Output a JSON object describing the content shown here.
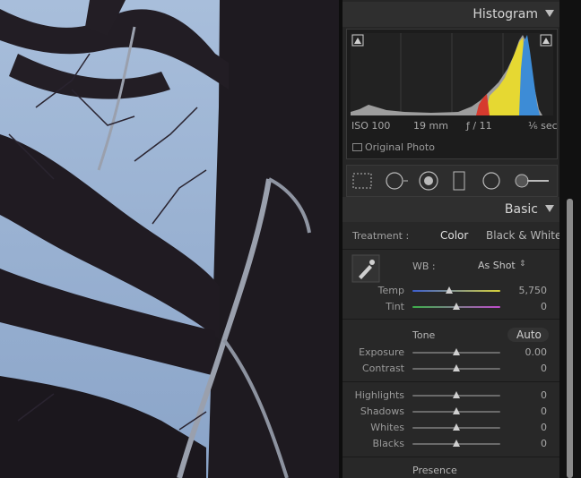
{
  "histogram": {
    "title": "Histogram",
    "iso": "ISO 100",
    "focal": "19 mm",
    "aperture": "ƒ / 11",
    "shutter": "⅙ sec",
    "original_photo": "Original Photo"
  },
  "tools": [
    "crop-overlay-icon",
    "spot-removal-icon",
    "red-eye-icon",
    "graduated-filter-icon",
    "radial-filter-icon",
    "adjustment-brush-icon"
  ],
  "basic": {
    "title": "Basic",
    "treatment_label": "Treatment :",
    "color": "Color",
    "bw": "Black & White",
    "wb_label": "WB :",
    "wb_value": "As Shot",
    "temp": {
      "label": "Temp",
      "value": "5,750",
      "level": 0.42
    },
    "tint": {
      "label": "Tint",
      "value": "0",
      "level": 0.5
    },
    "tone": "Tone",
    "auto": "Auto",
    "exposure": {
      "label": "Exposure",
      "value": "0.00",
      "level": 0.5
    },
    "contrast": {
      "label": "Contrast",
      "value": "0",
      "level": 0.5
    },
    "highlights": {
      "label": "Highlights",
      "value": "0",
      "level": 0.5
    },
    "shadows": {
      "label": "Shadows",
      "value": "0",
      "level": 0.5
    },
    "whites": {
      "label": "Whites",
      "value": "0",
      "level": 0.5
    },
    "blacks": {
      "label": "Blacks",
      "value": "0",
      "level": 0.5
    },
    "presence": "Presence"
  }
}
